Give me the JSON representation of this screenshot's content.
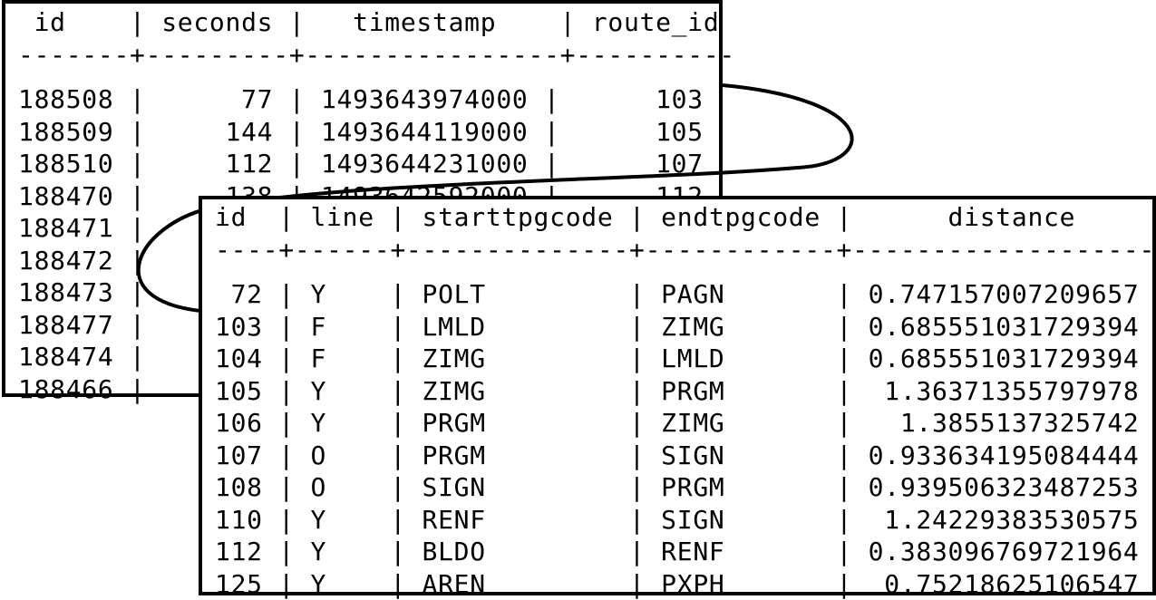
{
  "routes_table": {
    "header": " id    | seconds |   timestamp    | route_id",
    "separator": "-------+---------+----------------+----------",
    "rows": [
      "188508 |      77 | 1493643974000 |      103",
      "188509 |     144 | 1493644119000 |      105",
      "188510 |     112 | 1493644231000 |      107",
      "188470 |     138 | 1493642592000 |      112",
      "188471 |",
      "188472 |",
      "188473 |",
      "188477 |",
      "188474 |",
      "188466 |"
    ]
  },
  "lines_table": {
    "header": "id  | line | starttpgcode | endtpgcode |      distance",
    "separator": "----+------+--------------+------------+-------------------",
    "rows": [
      " 72 | Y    | POLT         | PAGN       | 0.747157007209657",
      "103 | F    | LMLD         | ZIMG       | 0.685551031729394",
      "104 | F    | ZIMG         | LMLD       | 0.685551031729394",
      "105 | Y    | ZIMG         | PRGM       |  1.36371355797978",
      "106 | Y    | PRGM         | ZIMG       |   1.3855137325742",
      "107 | O    | PRGM         | SIGN       | 0.933634195084444",
      "108 | O    | SIGN         | PRGM       | 0.939506323487253",
      "110 | Y    | RENF         | SIGN       |  1.24229383530575",
      "112 | Y    | BLDO         | RENF       | 0.383096769721964",
      "125 | Y    | AREN         | PXPH       |  0.75218625106547"
    ]
  },
  "connector": {
    "from": "routes_table.route_id",
    "to": "lines_table.id"
  }
}
